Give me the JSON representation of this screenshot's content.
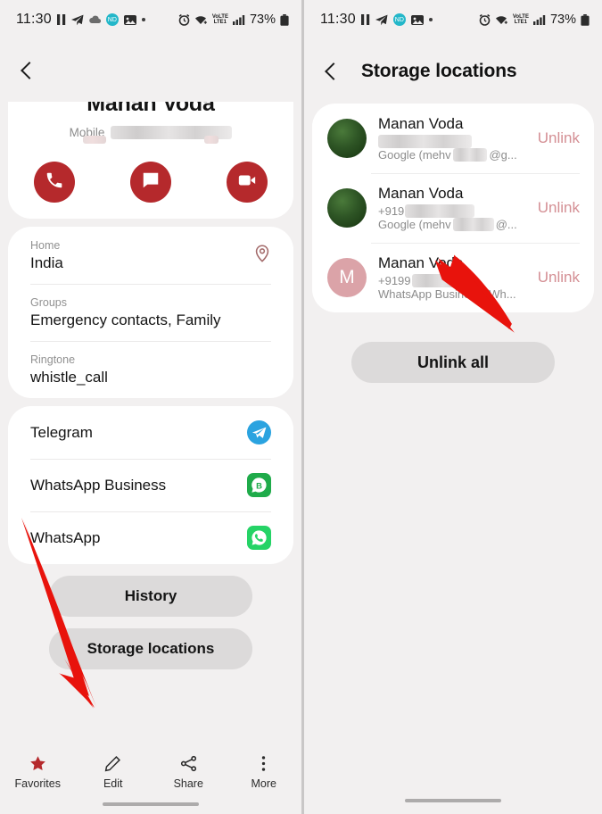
{
  "status_bar": {
    "time": "11:30",
    "battery": "73%",
    "volte_label_top": "VoLTE",
    "volte_label_bottom": "LTE1",
    "icons_left": [
      "pause-icon",
      "telegram-send-icon",
      "cloud-upload-icon",
      "teal-badge-icon",
      "photo-icon",
      "dot-icon"
    ],
    "icons_right": [
      "alarm-icon",
      "wifi-icon",
      "volte-icon",
      "signal-icon",
      "battery-icon"
    ]
  },
  "left_screen": {
    "back_label": "Back",
    "contact": {
      "name": "Manan Voda",
      "mobile_label": "Mobile",
      "mobile_value_redacted": true
    },
    "actions": [
      {
        "name": "call",
        "icon": "phone-icon"
      },
      {
        "name": "message",
        "icon": "message-icon"
      },
      {
        "name": "video-call",
        "icon": "video-camera-icon"
      }
    ],
    "details": [
      {
        "label": "Home",
        "value": "India",
        "icon": "map-pin-icon"
      },
      {
        "label": "Groups",
        "value": "Emergency contacts, Family",
        "icon": ""
      },
      {
        "label": "Ringtone",
        "value": "whistle_call",
        "icon": ""
      }
    ],
    "apps": [
      {
        "name": "Telegram",
        "icon": "telegram-icon"
      },
      {
        "name": "WhatsApp Business",
        "icon": "whatsapp-business-icon"
      },
      {
        "name": "WhatsApp",
        "icon": "whatsapp-icon"
      }
    ],
    "pills": [
      {
        "label": "History"
      },
      {
        "label": "Storage locations"
      }
    ],
    "bottom_nav": [
      {
        "label": "Favorites",
        "icon": "star-icon"
      },
      {
        "label": "Edit",
        "icon": "pencil-icon"
      },
      {
        "label": "Share",
        "icon": "share-icon"
      },
      {
        "label": "More",
        "icon": "more-vertical-icon"
      }
    ]
  },
  "right_screen": {
    "title": "Storage locations",
    "back_label": "Back",
    "locations": [
      {
        "name": "Manan Voda",
        "phone": "",
        "phone_redacted": true,
        "account": "Google (mehv",
        "account_tail": "@g...",
        "action": "Unlink",
        "avatar_type": "photo"
      },
      {
        "name": "Manan Voda",
        "phone": "+919",
        "phone_redacted": true,
        "account": "Google (mehv",
        "account_tail": "@...",
        "action": "Unlink",
        "avatar_type": "photo"
      },
      {
        "name": "Manan Voda",
        "phone": "+9199",
        "phone_redacted": true,
        "account": "WhatsApp Business (Wh...",
        "account_tail": "",
        "action": "Unlink",
        "avatar_type": "letter",
        "avatar_letter": "M"
      }
    ],
    "unlink_all_label": "Unlink all"
  },
  "annotations": {
    "arrow_color": "#e8130c",
    "arrows": [
      {
        "name": "arrow-to-storage-locations",
        "from": "WhatsApp Business label",
        "to": "Storage locations button"
      },
      {
        "name": "arrow-to-google-account-row",
        "from": "below list",
        "to": "second location account line"
      }
    ]
  },
  "colors": {
    "accent_red": "#b5292c",
    "unlink_pink": "#d48f94",
    "page_bg": "#f2f0f0",
    "card_bg": "#ffffff",
    "pill_bg": "#dcdada",
    "avatar_pink": "#dba3a8"
  }
}
